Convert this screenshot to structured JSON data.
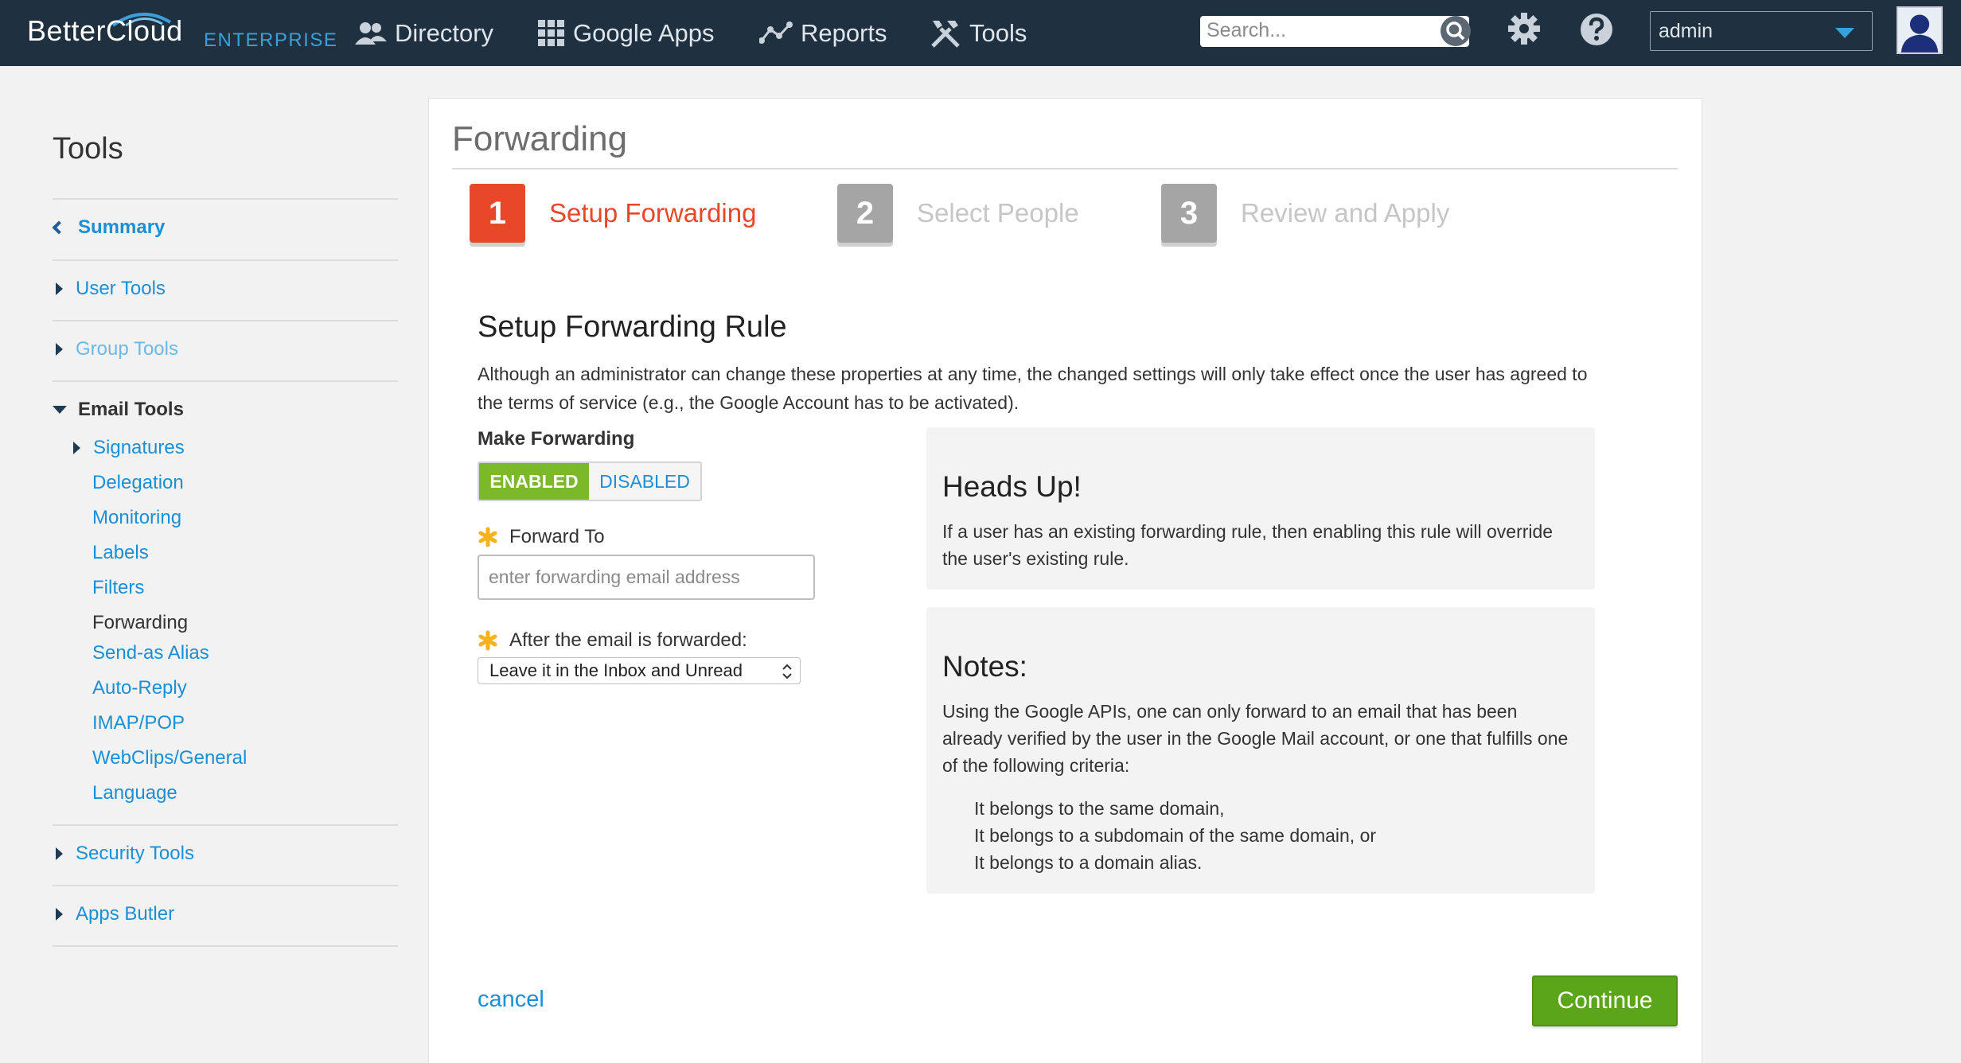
{
  "brand": {
    "name": "BetterCloud",
    "edition": "ENTERPRISE"
  },
  "nav": {
    "items": [
      {
        "label": "Directory",
        "icon": "users-icon"
      },
      {
        "label": "Google Apps",
        "icon": "grid-icon"
      },
      {
        "label": "Reports",
        "icon": "line-chart-icon"
      },
      {
        "label": "Tools",
        "icon": "tools-icon"
      }
    ],
    "search_placeholder": "Search...",
    "user": "admin"
  },
  "sidebar": {
    "title": "Tools",
    "summary": "Summary",
    "user_tools": "User Tools",
    "group_tools": "Group Tools",
    "email_tools": "Email Tools",
    "email_sub": {
      "signatures": "Signatures",
      "delegation": "Delegation",
      "monitoring": "Monitoring",
      "labels": "Labels",
      "filters": "Filters",
      "forwarding": "Forwarding",
      "send_as": "Send-as Alias",
      "auto_reply": "Auto-Reply",
      "imap_pop": "IMAP/POP",
      "webclips": "WebClips/General",
      "language": "Language"
    },
    "security_tools": "Security Tools",
    "apps_butler": "Apps Butler"
  },
  "main": {
    "title": "Forwarding",
    "steps": [
      {
        "number": "1",
        "label": "Setup Forwarding",
        "active": true
      },
      {
        "number": "2",
        "label": "Select People",
        "active": false
      },
      {
        "number": "3",
        "label": "Review and Apply",
        "active": false
      }
    ],
    "section_title": "Setup Forwarding Rule",
    "description": "Although an administrator can change these properties at any time, the changed settings will only take effect once the user has agreed to the terms of service (e.g., the Google Account has to be activated).",
    "make_forwarding_label": "Make Forwarding",
    "toggle_on": "ENABLED",
    "toggle_off": "DISABLED",
    "forward_to_label": "Forward To",
    "forward_to_placeholder": "enter forwarding email address",
    "after_label": "After the email is forwarded:",
    "after_value": "Leave it in the Inbox and Unread",
    "heads_up_title": "Heads Up!",
    "heads_up_text": "If a user has an existing forwarding rule, then enabling this rule will override the user's existing rule.",
    "notes_title": "Notes:",
    "notes_text": "Using the Google APIs, one can only forward to an email that has been already verified by the user in the Google Mail account, or one that fulfills one of the following criteria:",
    "notes_criteria": [
      "It belongs to the same domain,",
      "It belongs to a subdomain of the same domain, or",
      "It belongs to a domain alias."
    ],
    "cancel": "cancel",
    "continue": "Continue"
  },
  "colors": {
    "navbar": "#1f3040",
    "link": "#1b8fd6",
    "active_step": "#e8472a",
    "inactive_step": "#a5a5a5",
    "enabled": "#7cb92a",
    "continue": "#5aa51a"
  }
}
